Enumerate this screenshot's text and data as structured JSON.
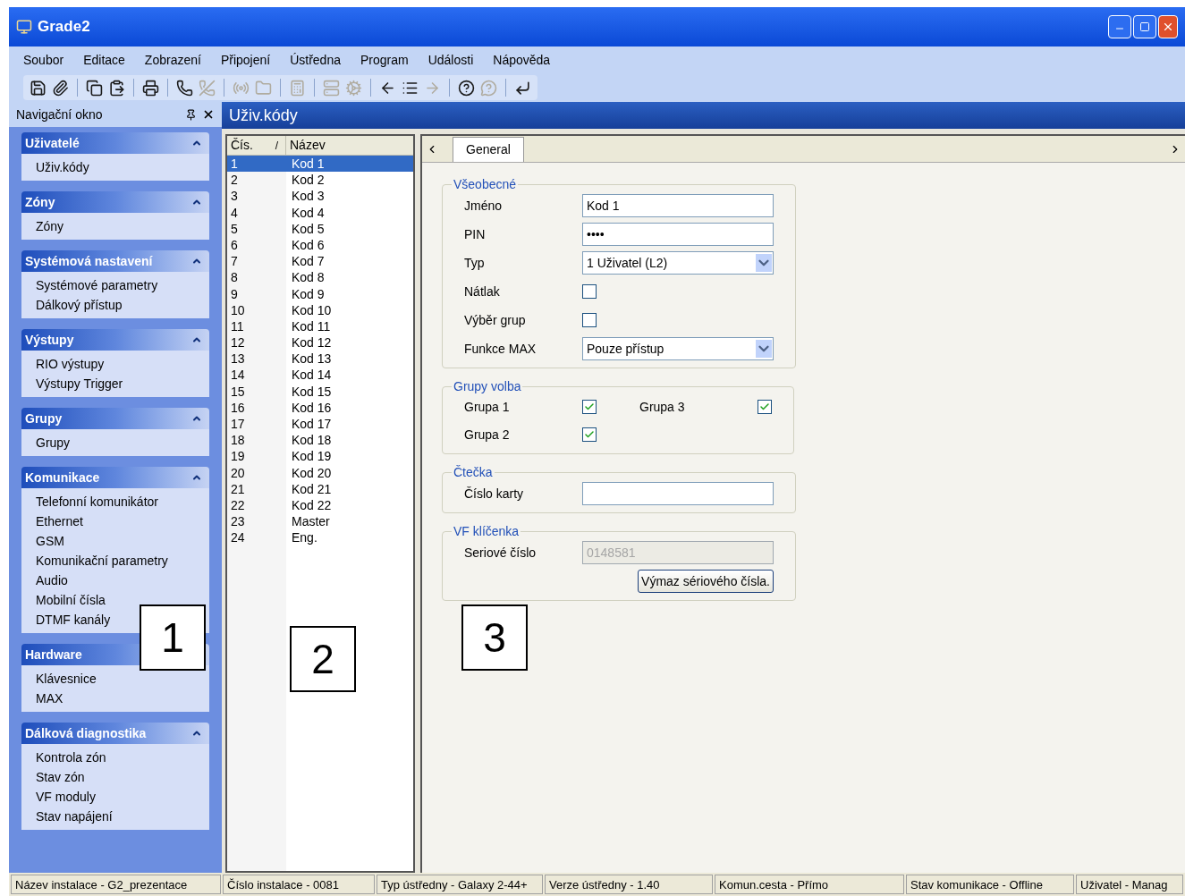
{
  "window": {
    "title": "Grade2"
  },
  "menu": [
    "Soubor",
    "Editace",
    "Zobrazení",
    "Připojení",
    "Ústředna",
    "Program",
    "Události",
    "Nápověda"
  ],
  "toolbar_groups": [
    [
      {
        "disabled": false
      },
      {
        "disabled": false
      }
    ],
    [
      {
        "disabled": false
      },
      {
        "disabled": false
      }
    ],
    [
      {
        "disabled": false
      }
    ],
    [
      {
        "disabled": false
      },
      {
        "disabled": true
      }
    ],
    [
      {
        "disabled": true
      },
      {
        "disabled": true
      }
    ],
    [
      {
        "disabled": true
      }
    ],
    [
      {
        "disabled": true
      },
      {
        "disabled": true
      }
    ],
    [
      {
        "disabled": false
      },
      {
        "disabled": false
      },
      {
        "disabled": true
      }
    ],
    [
      {
        "disabled": false
      },
      {
        "disabled": true
      }
    ],
    [
      {
        "disabled": false
      }
    ]
  ],
  "nav": {
    "title": "Navigační okno",
    "sections": [
      {
        "title": "Uživatelé",
        "expanded": true,
        "arrow_shown": true,
        "items": [
          "Uživ.kódy"
        ]
      },
      {
        "title": "Zóny",
        "expanded": true,
        "arrow_shown": true,
        "items": [
          "Zóny"
        ]
      },
      {
        "title": "Systémová nastavení",
        "expanded": true,
        "arrow_shown": true,
        "items": [
          "Systémové parametry",
          "Dálkový přístup"
        ]
      },
      {
        "title": "Výstupy",
        "expanded": true,
        "arrow_shown": true,
        "items": [
          "RIO výstupy",
          "Výstupy Trigger"
        ]
      },
      {
        "title": "Grupy",
        "expanded": true,
        "arrow_shown": true,
        "items": [
          "Grupy"
        ]
      },
      {
        "title": "Komunikace",
        "expanded": true,
        "arrow_shown": true,
        "items": [
          "Telefonní komunikátor",
          "Ethernet",
          "GSM",
          "Komunikační parametry",
          "Audio",
          "Mobilní čísla",
          "DTMF kanály"
        ]
      },
      {
        "title": "Hardware",
        "expanded": true,
        "arrow_shown": false,
        "items": [
          "Klávesnice",
          "MAX"
        ]
      },
      {
        "title": "Dálková diagnostika",
        "expanded": true,
        "arrow_shown": true,
        "items": [
          "Kontrola zón",
          "Stav zón",
          "VF moduly",
          "Stav napájení"
        ]
      }
    ]
  },
  "pane_title": "Uživ.kódy",
  "table": {
    "columns": [
      "Čís.",
      "Název"
    ],
    "sort_mark": "/",
    "rows": [
      {
        "num": "1",
        "name": "Kod 1",
        "selected": true
      },
      {
        "num": "2",
        "name": "Kod 2",
        "selected": false
      },
      {
        "num": "3",
        "name": "Kod 3",
        "selected": false
      },
      {
        "num": "4",
        "name": "Kod 4",
        "selected": false
      },
      {
        "num": "5",
        "name": "Kod 5",
        "selected": false
      },
      {
        "num": "6",
        "name": "Kod 6",
        "selected": false
      },
      {
        "num": "7",
        "name": "Kod 7",
        "selected": false
      },
      {
        "num": "8",
        "name": "Kod 8",
        "selected": false
      },
      {
        "num": "9",
        "name": "Kod 9",
        "selected": false
      },
      {
        "num": "10",
        "name": "Kod 10",
        "selected": false
      },
      {
        "num": "11",
        "name": "Kod 11",
        "selected": false
      },
      {
        "num": "12",
        "name": "Kod 12",
        "selected": false
      },
      {
        "num": "13",
        "name": "Kod 13",
        "selected": false
      },
      {
        "num": "14",
        "name": "Kod 14",
        "selected": false
      },
      {
        "num": "15",
        "name": "Kod 15",
        "selected": false
      },
      {
        "num": "16",
        "name": "Kod 16",
        "selected": false
      },
      {
        "num": "17",
        "name": "Kod 17",
        "selected": false
      },
      {
        "num": "18",
        "name": "Kod 18",
        "selected": false
      },
      {
        "num": "19",
        "name": "Kod 19",
        "selected": false
      },
      {
        "num": "20",
        "name": "Kod 20",
        "selected": false
      },
      {
        "num": "21",
        "name": "Kod 21",
        "selected": false
      },
      {
        "num": "22",
        "name": "Kod 22",
        "selected": false
      },
      {
        "num": "23",
        "name": "Master",
        "selected": false
      },
      {
        "num": "24",
        "name": "Eng.",
        "selected": false
      }
    ]
  },
  "tabs": [
    {
      "label": "General",
      "selected": true
    }
  ],
  "groups": [
    {
      "title": "Všeobecné",
      "fields": [
        {
          "kind": "text",
          "label": "Jméno",
          "value": "Kod 1"
        },
        {
          "kind": "text",
          "label": "PIN",
          "value": "••••"
        },
        {
          "kind": "select",
          "label": "Typ",
          "value": "1 Uživatel (L2)"
        },
        {
          "kind": "checkbox",
          "label": "Nátlak",
          "checked": false
        },
        {
          "kind": "checkbox",
          "label": "Výběr grup",
          "checked": false
        },
        {
          "kind": "select",
          "label": "Funkce MAX",
          "value": "Pouze přístup"
        }
      ]
    },
    {
      "title": "Grupy volba",
      "fields": [
        {
          "kind": "pair",
          "label": "Grupa 1",
          "checked": true,
          "label2": "Grupa 3",
          "checked2": true
        },
        {
          "kind": "checkbox",
          "label": "Grupa 2",
          "checked": true
        }
      ]
    },
    {
      "title": "Čtečka",
      "fields": [
        {
          "kind": "text",
          "label": "Číslo karty"
        }
      ]
    },
    {
      "title": "VF klíčenka",
      "fields": [
        {
          "kind": "disabled",
          "label": "Seriové číslo",
          "value": "0148581"
        },
        {
          "kind": "button",
          "label": "Výmaz sériového čísla."
        }
      ]
    }
  ],
  "status_bar": [
    "Název instalace - G2_prezentace",
    "Číslo instalace - 0081",
    "Typ ústředny - Galaxy 2-44+",
    "Verze ústředny - 1.40",
    "Komun.cesta - Přímo",
    "Stav komunikace - Offline",
    "Uživatel - Manag"
  ],
  "callouts": [
    "1",
    "2",
    "3"
  ]
}
